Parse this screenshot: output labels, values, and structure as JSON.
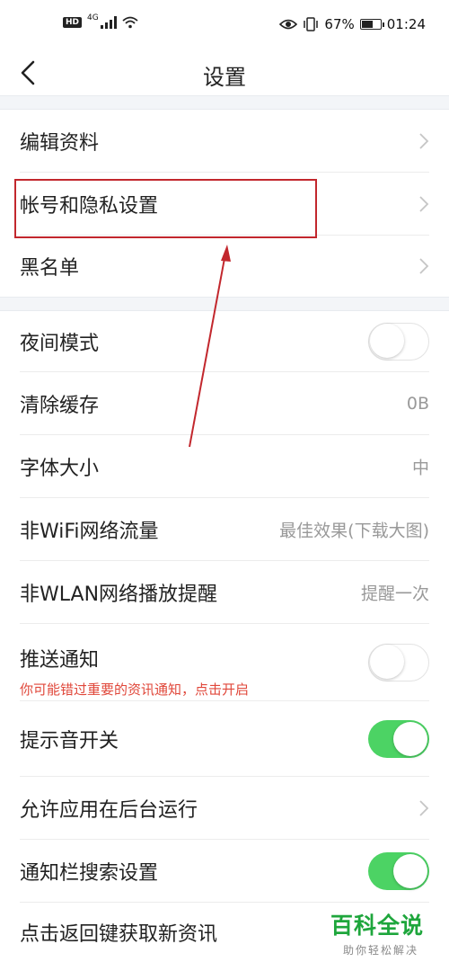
{
  "status_bar": {
    "hd": "HD",
    "network": "4G",
    "battery": "67%",
    "battery_level": 0.67,
    "time": "01:24"
  },
  "nav": {
    "title": "设置"
  },
  "section1": [
    {
      "label": "编辑资料"
    },
    {
      "label": "帐号和隐私设置"
    },
    {
      "label": "黑名单"
    }
  ],
  "section2": {
    "night_mode": {
      "label": "夜间模式",
      "on": false
    },
    "clear_cache": {
      "label": "清除缓存",
      "value": "0B"
    },
    "font_size": {
      "label": "字体大小",
      "value": "中"
    },
    "non_wifi": {
      "label": "非WiFi网络流量",
      "value": "最佳效果(下载大图)"
    },
    "non_wlan": {
      "label": "非WLAN网络播放提醒",
      "value": "提醒一次"
    },
    "push": {
      "label": "推送通知",
      "sub": "你可能错过重要的资讯通知，点击开启",
      "on": false
    },
    "sound": {
      "label": "提示音开关",
      "on": true
    },
    "background": {
      "label": "允许应用在后台运行"
    },
    "notif_search": {
      "label": "通知栏搜索设置",
      "on": true
    },
    "back_refresh": {
      "label": "点击返回键获取新资讯"
    }
  },
  "watermark": {
    "title": "百科全说",
    "subtitle": "助你轻松解决"
  },
  "colors": {
    "toggle_on": "#4cd364",
    "highlight": "#c2272d",
    "warning_text": "#e0473a",
    "watermark": "#1ea63c"
  }
}
